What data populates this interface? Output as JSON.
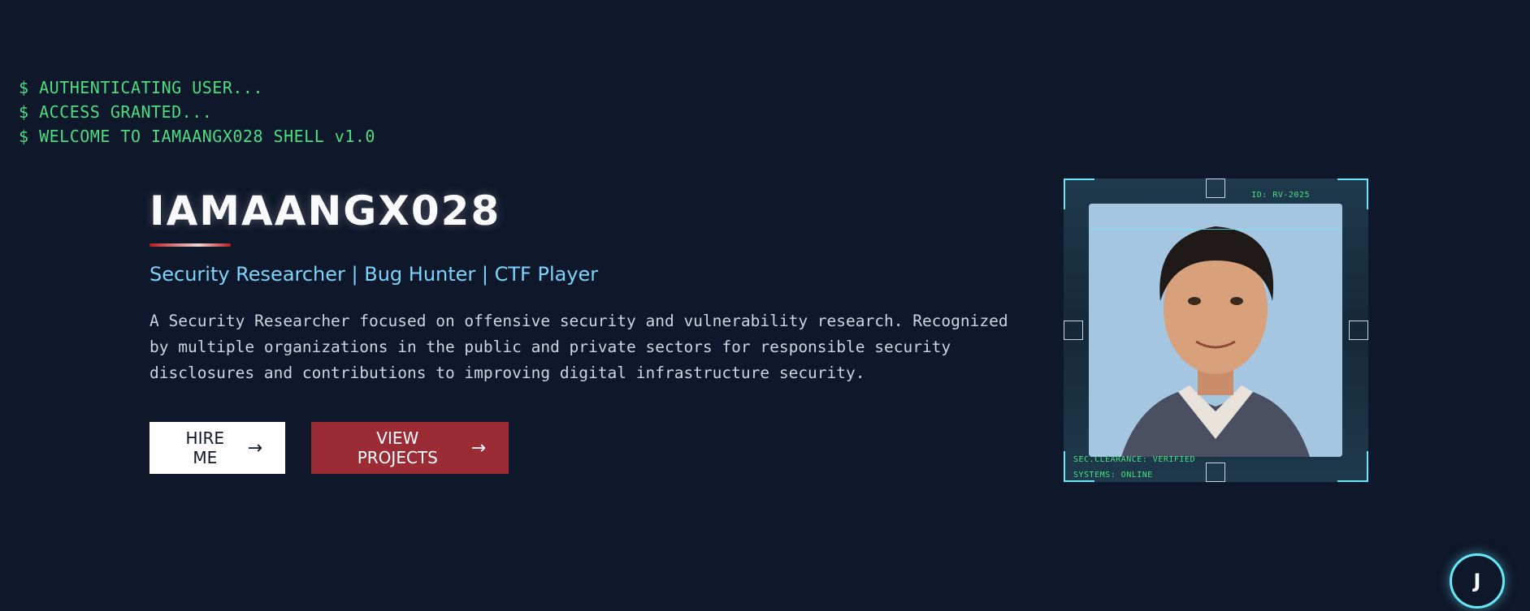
{
  "terminal": {
    "lines": [
      "$ AUTHENTICATING USER...",
      "$ ACCESS GRANTED...",
      "$ WELCOME TO IAMAANGX028 SHELL v1.0"
    ]
  },
  "hero": {
    "title": "IAMAANGX028",
    "subtitle": "Security Researcher | Bug Hunter | CTF Player",
    "description": "A Security Researcher focused on offensive security and vulnerability research. Recognized by multiple organizations in the public and private sectors for responsible security disclosures and contributions to improving digital infrastructure security.",
    "buttons": {
      "hire_label": "HIRE ME",
      "view_label": "VIEW PROJECTS",
      "arrow": "→"
    }
  },
  "profile_card": {
    "id_label": "ID: RV-2025",
    "clearance": "SEC.CLEARANCE: VERIFIED",
    "systems": "SYSTEMS: ONLINE"
  },
  "floating_button": {
    "label": "J"
  },
  "colors": {
    "background": "#0f172a",
    "terminal_green": "#4ade80",
    "accent_cyan": "#7dd3fc",
    "accent_red": "#9b2c35"
  }
}
